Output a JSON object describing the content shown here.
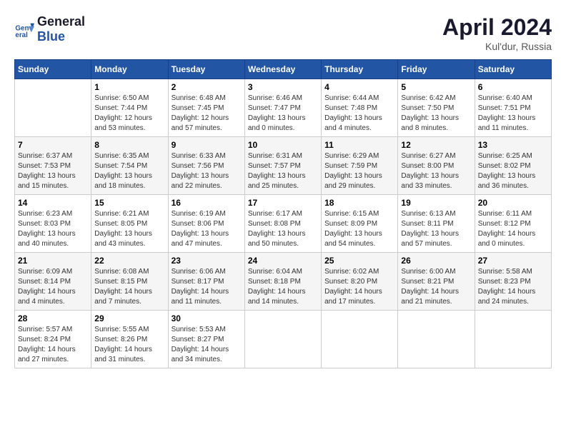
{
  "header": {
    "logo_line1": "General",
    "logo_line2": "Blue",
    "month_year": "April 2024",
    "location": "Kul'dur, Russia"
  },
  "weekdays": [
    "Sunday",
    "Monday",
    "Tuesday",
    "Wednesday",
    "Thursday",
    "Friday",
    "Saturday"
  ],
  "weeks": [
    [
      {
        "day": "",
        "info": ""
      },
      {
        "day": "1",
        "info": "Sunrise: 6:50 AM\nSunset: 7:44 PM\nDaylight: 12 hours\nand 53 minutes."
      },
      {
        "day": "2",
        "info": "Sunrise: 6:48 AM\nSunset: 7:45 PM\nDaylight: 12 hours\nand 57 minutes."
      },
      {
        "day": "3",
        "info": "Sunrise: 6:46 AM\nSunset: 7:47 PM\nDaylight: 13 hours\nand 0 minutes."
      },
      {
        "day": "4",
        "info": "Sunrise: 6:44 AM\nSunset: 7:48 PM\nDaylight: 13 hours\nand 4 minutes."
      },
      {
        "day": "5",
        "info": "Sunrise: 6:42 AM\nSunset: 7:50 PM\nDaylight: 13 hours\nand 8 minutes."
      },
      {
        "day": "6",
        "info": "Sunrise: 6:40 AM\nSunset: 7:51 PM\nDaylight: 13 hours\nand 11 minutes."
      }
    ],
    [
      {
        "day": "7",
        "info": "Sunrise: 6:37 AM\nSunset: 7:53 PM\nDaylight: 13 hours\nand 15 minutes."
      },
      {
        "day": "8",
        "info": "Sunrise: 6:35 AM\nSunset: 7:54 PM\nDaylight: 13 hours\nand 18 minutes."
      },
      {
        "day": "9",
        "info": "Sunrise: 6:33 AM\nSunset: 7:56 PM\nDaylight: 13 hours\nand 22 minutes."
      },
      {
        "day": "10",
        "info": "Sunrise: 6:31 AM\nSunset: 7:57 PM\nDaylight: 13 hours\nand 25 minutes."
      },
      {
        "day": "11",
        "info": "Sunrise: 6:29 AM\nSunset: 7:59 PM\nDaylight: 13 hours\nand 29 minutes."
      },
      {
        "day": "12",
        "info": "Sunrise: 6:27 AM\nSunset: 8:00 PM\nDaylight: 13 hours\nand 33 minutes."
      },
      {
        "day": "13",
        "info": "Sunrise: 6:25 AM\nSunset: 8:02 PM\nDaylight: 13 hours\nand 36 minutes."
      }
    ],
    [
      {
        "day": "14",
        "info": "Sunrise: 6:23 AM\nSunset: 8:03 PM\nDaylight: 13 hours\nand 40 minutes."
      },
      {
        "day": "15",
        "info": "Sunrise: 6:21 AM\nSunset: 8:05 PM\nDaylight: 13 hours\nand 43 minutes."
      },
      {
        "day": "16",
        "info": "Sunrise: 6:19 AM\nSunset: 8:06 PM\nDaylight: 13 hours\nand 47 minutes."
      },
      {
        "day": "17",
        "info": "Sunrise: 6:17 AM\nSunset: 8:08 PM\nDaylight: 13 hours\nand 50 minutes."
      },
      {
        "day": "18",
        "info": "Sunrise: 6:15 AM\nSunset: 8:09 PM\nDaylight: 13 hours\nand 54 minutes."
      },
      {
        "day": "19",
        "info": "Sunrise: 6:13 AM\nSunset: 8:11 PM\nDaylight: 13 hours\nand 57 minutes."
      },
      {
        "day": "20",
        "info": "Sunrise: 6:11 AM\nSunset: 8:12 PM\nDaylight: 14 hours\nand 0 minutes."
      }
    ],
    [
      {
        "day": "21",
        "info": "Sunrise: 6:09 AM\nSunset: 8:14 PM\nDaylight: 14 hours\nand 4 minutes."
      },
      {
        "day": "22",
        "info": "Sunrise: 6:08 AM\nSunset: 8:15 PM\nDaylight: 14 hours\nand 7 minutes."
      },
      {
        "day": "23",
        "info": "Sunrise: 6:06 AM\nSunset: 8:17 PM\nDaylight: 14 hours\nand 11 minutes."
      },
      {
        "day": "24",
        "info": "Sunrise: 6:04 AM\nSunset: 8:18 PM\nDaylight: 14 hours\nand 14 minutes."
      },
      {
        "day": "25",
        "info": "Sunrise: 6:02 AM\nSunset: 8:20 PM\nDaylight: 14 hours\nand 17 minutes."
      },
      {
        "day": "26",
        "info": "Sunrise: 6:00 AM\nSunset: 8:21 PM\nDaylight: 14 hours\nand 21 minutes."
      },
      {
        "day": "27",
        "info": "Sunrise: 5:58 AM\nSunset: 8:23 PM\nDaylight: 14 hours\nand 24 minutes."
      }
    ],
    [
      {
        "day": "28",
        "info": "Sunrise: 5:57 AM\nSunset: 8:24 PM\nDaylight: 14 hours\nand 27 minutes."
      },
      {
        "day": "29",
        "info": "Sunrise: 5:55 AM\nSunset: 8:26 PM\nDaylight: 14 hours\nand 31 minutes."
      },
      {
        "day": "30",
        "info": "Sunrise: 5:53 AM\nSunset: 8:27 PM\nDaylight: 14 hours\nand 34 minutes."
      },
      {
        "day": "",
        "info": ""
      },
      {
        "day": "",
        "info": ""
      },
      {
        "day": "",
        "info": ""
      },
      {
        "day": "",
        "info": ""
      }
    ]
  ]
}
